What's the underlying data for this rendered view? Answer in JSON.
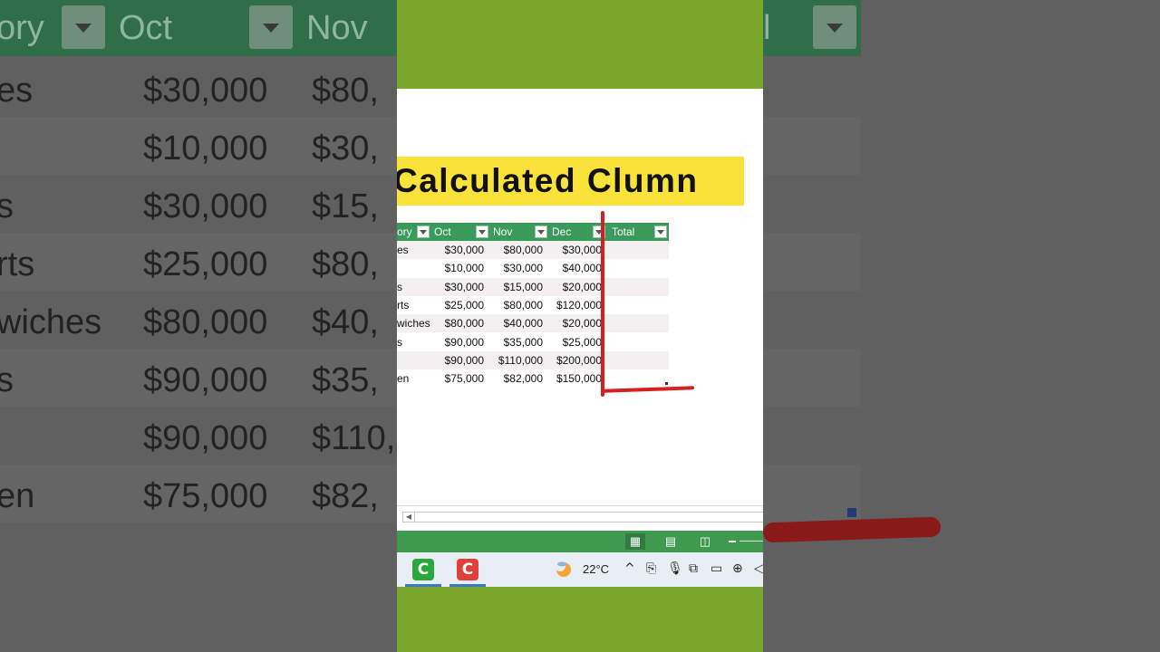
{
  "title": "Calculated Clumn",
  "table": {
    "headers": [
      "ory",
      "Oct",
      "Nov",
      "Dec",
      "Total"
    ],
    "rows": [
      [
        "es",
        "$30,000",
        "$80,000",
        "$30,000"
      ],
      [
        "",
        "$10,000",
        "$30,000",
        "$40,000"
      ],
      [
        "s",
        "$30,000",
        "$15,000",
        "$20,000"
      ],
      [
        "rts",
        "$25,000",
        "$80,000",
        "$120,000"
      ],
      [
        "wiches",
        "$80,000",
        "$40,000",
        "$20,000"
      ],
      [
        "s",
        "$90,000",
        "$35,000",
        "$25,000"
      ],
      [
        "",
        "$90,000",
        "$110,000",
        "$200,000"
      ],
      [
        "en",
        "$75,000",
        "$82,000",
        "$150,000"
      ]
    ]
  },
  "background": {
    "headers": [
      "ory",
      "Oct",
      "Nov"
    ],
    "rows": [
      [
        "es",
        "$30,000",
        "$80,"
      ],
      [
        "",
        "$10,000",
        "$30,"
      ],
      [
        "s",
        "$30,000",
        "$15,"
      ],
      [
        "rts",
        "$25,000",
        "$80,"
      ],
      [
        "wiches",
        "$80,000",
        "$40,"
      ],
      [
        "s",
        "$90,000",
        "$35,"
      ],
      [
        "",
        "$90,000",
        "$110,"
      ],
      [
        "en",
        "$75,000",
        "$82,"
      ]
    ],
    "dim_header_edge": "l"
  },
  "statusbar": {
    "views": [
      "normal-view-icon",
      "page-layout-icon",
      "page-break-icon"
    ],
    "zoom_out": "–"
  },
  "taskbar": {
    "apps": [
      {
        "name": "camtasia-green",
        "glyph": "C",
        "color": "#2aa83a"
      },
      {
        "name": "camtasia-red",
        "glyph": "C",
        "color": "#e0403a"
      }
    ],
    "temperature": "22°C",
    "tray_icons": [
      "chevron-up-icon",
      "camera-icon",
      "microphone-icon",
      "display-icon",
      "battery-icon",
      "globe-icon",
      "speaker-icon"
    ]
  },
  "colors": {
    "panel_green": "#7aa62c",
    "table_header": "#3a9a5a",
    "title_highlight": "#f9e23a",
    "annotation_red": "#d42020"
  }
}
